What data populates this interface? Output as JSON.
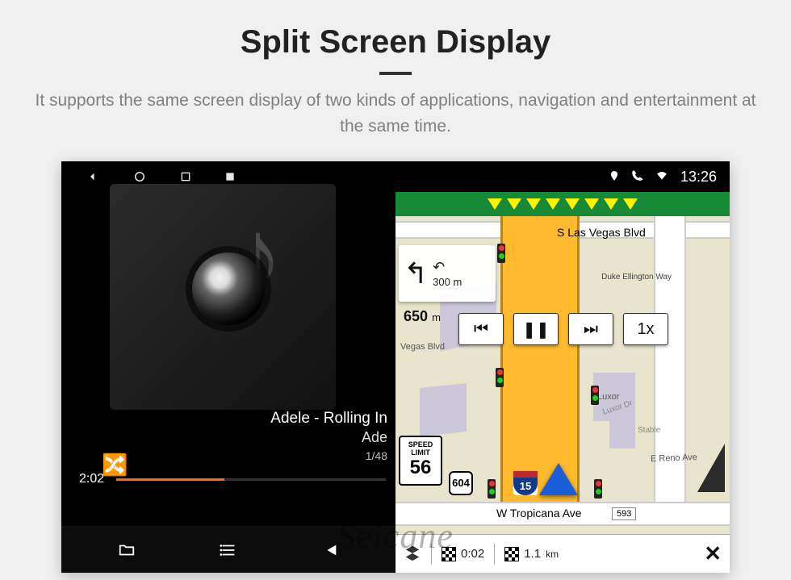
{
  "heading": "Split Screen Display",
  "subtitle": "It supports the same screen display of two kinds of applications, navigation and entertainment at the same time.",
  "statusbar": {
    "time": "13:26"
  },
  "music": {
    "track_title": "Adele - Rolling In",
    "artist": "Ade",
    "track_counter": "1/48",
    "elapsed": "2:02"
  },
  "nav": {
    "street_top": "S Las Vegas Blvd",
    "street_right": "Duke Ellington Way",
    "vegas_label": "Vegas Blvd",
    "street_bottom": "W Tropicana Ave",
    "street_bottom_num": "593",
    "luxor": "Luxor",
    "luxor_dr": "Luxor Dr",
    "stable": "Stable",
    "reno": "E Reno Ave",
    "turn_next": {
      "dist300": "300",
      "unit300": "m"
    },
    "turn_main": "650",
    "turn_main_unit": "m",
    "controls": {
      "prev": "⏮",
      "pause": "❚❚",
      "next": "⏭",
      "speed": "1x"
    },
    "speed_limit": {
      "l1": "SPEED",
      "l2": "LIMIT",
      "val": "56"
    },
    "shield_604": "604",
    "shield_i15": "15",
    "bottom": {
      "eta": "0:02",
      "dist": "1.1",
      "dist_unit": "km"
    }
  },
  "watermark": "Seicane"
}
